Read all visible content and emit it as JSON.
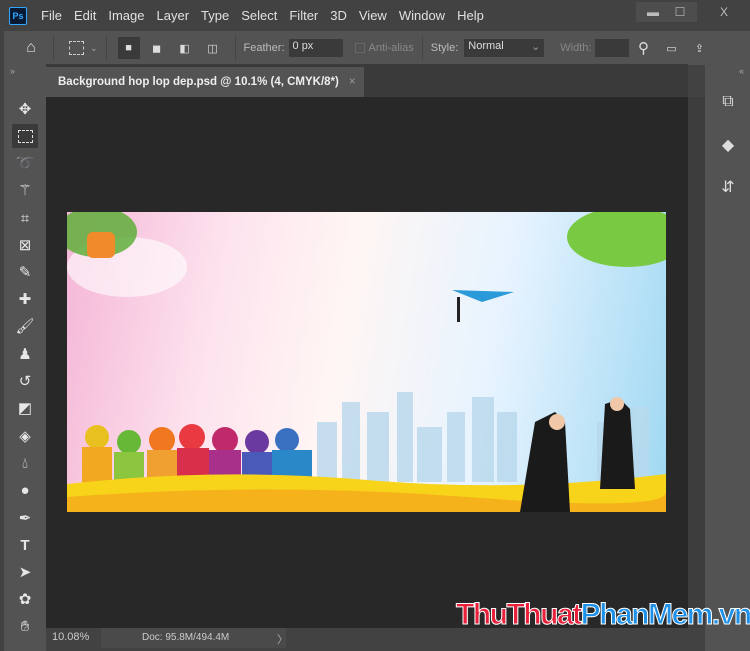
{
  "app": {
    "logo": "Ps"
  },
  "menu": [
    "File",
    "Edit",
    "Image",
    "Layer",
    "Type",
    "Select",
    "Filter",
    "3D",
    "View",
    "Window",
    "Help"
  ],
  "window_controls": {
    "minimize": "▬",
    "maximize": "☐",
    "close": "X"
  },
  "options": {
    "feather_label": "Feather:",
    "feather_value": "0 px",
    "antialias_label": "Anti-alias",
    "style_label": "Style:",
    "style_value": "Normal",
    "width_label": "Width:"
  },
  "document": {
    "tab_title": "Background hop lop dep.psd @ 10.1% (4, CMYK/8*)",
    "close": "×"
  },
  "status": {
    "zoom": "10.08%",
    "doc": "Doc: 95.8M/494.4M",
    "arrow": "〉"
  },
  "panel_collapse": {
    "left": "»",
    "right": "«"
  },
  "tools": [
    "move",
    "rectangular-marquee",
    "lasso",
    "magic-wand",
    "crop",
    "frame",
    "eyedropper",
    "healing-brush",
    "brush",
    "clone-stamp",
    "history-brush",
    "eraser",
    "paint-bucket",
    "blur",
    "dodge",
    "pen",
    "type",
    "path-selection",
    "custom-shape",
    "hand"
  ],
  "watermark": {
    "part1": "ThuThuat",
    "part2": "PhanMem",
    "part3": ".vn",
    "color1": "#e8203a",
    "color2": "#1e90e8"
  }
}
